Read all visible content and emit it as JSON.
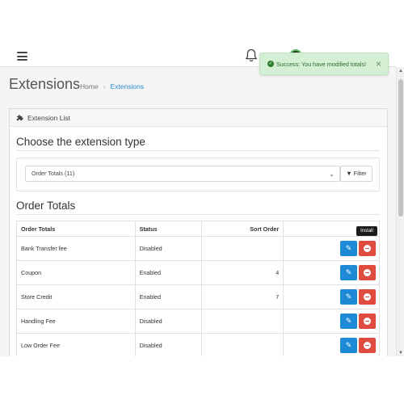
{
  "header": {
    "menu_icon": "hamburger-icon",
    "notification_icon": "bell-icon",
    "avatar_icon": "user-avatar"
  },
  "alert": {
    "message": "Success: You have modified totals!",
    "close_label": "×",
    "colors": {
      "background": "#d4efd4",
      "text": "#2f6b2f"
    }
  },
  "page": {
    "title": "Extensions",
    "breadcrumb": [
      "Home",
      "Extensions"
    ]
  },
  "card": {
    "header_label": "Extension List",
    "header_icon": "puzzle-icon",
    "choose_heading": "Choose the extension type",
    "select_value": "Order Totals (11)",
    "filter_label": "Filter",
    "section_heading": "Order Totals"
  },
  "table": {
    "columns": [
      "Order Totals",
      "Status",
      "Sort Order",
      ""
    ],
    "rows": [
      {
        "name": "Bank Transfer fee",
        "status": "Disabled",
        "sort": ""
      },
      {
        "name": "Coupon",
        "status": "Enabled",
        "sort": "4"
      },
      {
        "name": "Store Credit",
        "status": "Enabled",
        "sort": "7"
      },
      {
        "name": "Handling Fee",
        "status": "Disabled",
        "sort": ""
      },
      {
        "name": "Low Order Fee",
        "status": "Disabled",
        "sort": ""
      }
    ]
  },
  "tooltip": {
    "text": "Install"
  },
  "colors": {
    "primary": "#1e8ad6",
    "danger": "#e04b3f",
    "link": "#2b8dd0"
  }
}
